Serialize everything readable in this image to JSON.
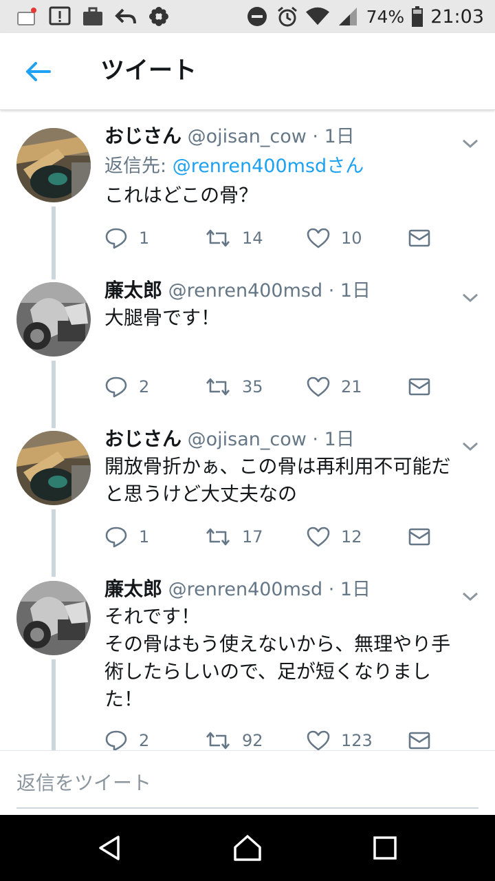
{
  "status_bar": {
    "battery": "74%",
    "time": "21:03"
  },
  "header": {
    "title": "ツイート"
  },
  "tweets": [
    {
      "name": "おじさん",
      "handle": "@ojisan_cow",
      "time": "· 1日",
      "reply_prefix": "返信先: ",
      "reply_mention": "@renren400msdさん",
      "text": "これはどこの骨？",
      "replies": "1",
      "retweets": "14",
      "likes": "10"
    },
    {
      "name": "廉太郎",
      "handle": "@renren400msd",
      "time": "· 1日",
      "text": "大腿骨です！",
      "replies": "2",
      "retweets": "35",
      "likes": "21"
    },
    {
      "name": "おじさん",
      "handle": "@ojisan_cow",
      "time": "· 1日",
      "text": "開放骨折かぁ、この骨は再利用不可能だ\nと思うけど大丈夫なの",
      "replies": "1",
      "retweets": "17",
      "likes": "12"
    },
    {
      "name": "廉太郎",
      "handle": "@renren400msd",
      "time": "· 1日",
      "text": "それです！\nその骨はもう使えないから、無理やり手\n術したらしいので、足が短くなりまし\nた！",
      "replies": "2",
      "retweets": "92",
      "likes": "123"
    }
  ],
  "compose": {
    "placeholder": "返信をツイート"
  },
  "colors": {
    "accent": "#1da1f2",
    "text": "#14171a",
    "secondary": "#657786",
    "thread_line": "#ccd6dd"
  }
}
